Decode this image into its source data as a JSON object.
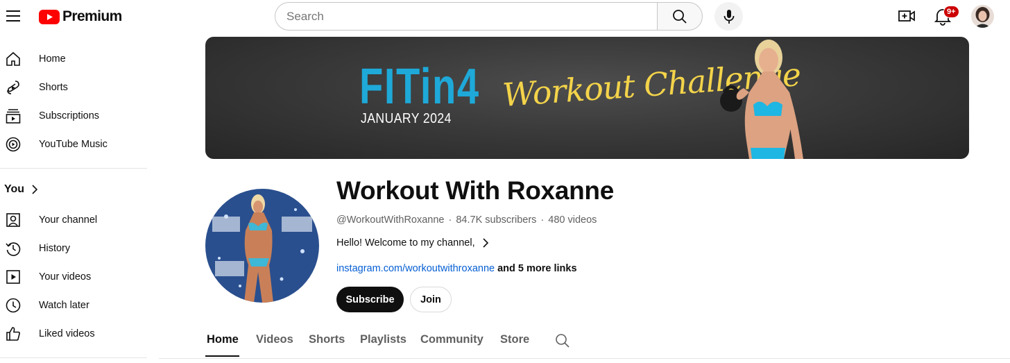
{
  "topbar": {
    "logo_text": "Premium",
    "search_placeholder": "Search",
    "notifications_badge": "9+"
  },
  "sidebar": {
    "items": [
      {
        "label": "Home",
        "icon": "home-icon"
      },
      {
        "label": "Shorts",
        "icon": "shorts-icon"
      },
      {
        "label": "Subscriptions",
        "icon": "subscriptions-icon"
      },
      {
        "label": "YouTube Music",
        "icon": "youtube-music-icon"
      }
    ],
    "you_heading": "You",
    "you_items": [
      {
        "label": "Your channel",
        "icon": "your-channel-icon"
      },
      {
        "label": "History",
        "icon": "history-icon"
      },
      {
        "label": "Your videos",
        "icon": "your-videos-icon"
      },
      {
        "label": "Watch later",
        "icon": "watch-later-icon"
      },
      {
        "label": "Liked videos",
        "icon": "liked-videos-icon"
      }
    ]
  },
  "banner": {
    "headline": "FITin4",
    "date": "JANUARY 2024",
    "script_text": "Workout Challenge"
  },
  "channel": {
    "name": "Workout With Roxanne",
    "handle": "@WorkoutWithRoxanne",
    "separator": "·",
    "subscribers": "84.7K subscribers",
    "videos": "480 videos",
    "description": "Hello! Welcome to my channel,",
    "link": "instagram.com/workoutwithroxanne",
    "more_links": "and 5 more links",
    "subscribe_label": "Subscribe",
    "join_label": "Join"
  },
  "tabs": [
    {
      "label": "Home",
      "active": true
    },
    {
      "label": "Videos",
      "active": false
    },
    {
      "label": "Shorts",
      "active": false
    },
    {
      "label": "Playlists",
      "active": false
    },
    {
      "label": "Community",
      "active": false
    },
    {
      "label": "Store",
      "active": false
    }
  ],
  "colors": {
    "brand_red": "#ff0000",
    "link_blue": "#065fd4",
    "banner_accent": "#1ea9d8",
    "script_gold": "#f3d34a"
  }
}
